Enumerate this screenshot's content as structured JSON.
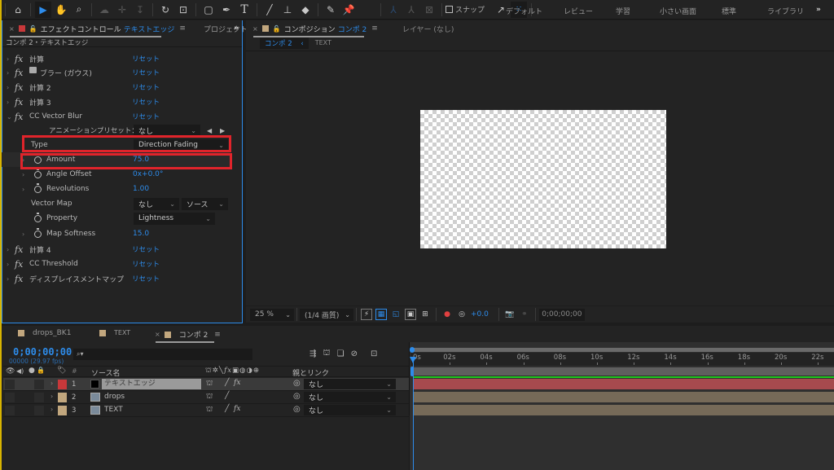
{
  "toolbar": {
    "tools": [
      "home-icon",
      "selection-tool-icon",
      "hand-tool-icon",
      "zoom-tool-icon",
      "orbit-camera-icon",
      "pan-camera-icon",
      "dolly-camera-icon",
      "rotate-tool-icon",
      "anchor-point-tool-icon",
      "rectangle-tool-icon",
      "pen-tool-icon",
      "type-tool-icon",
      "brush-tool-icon",
      "clone-stamp-icon",
      "eraser-icon",
      "roto-brush-icon",
      "puppet-pin-icon"
    ],
    "snap_label": "スナップ",
    "workspaces": [
      "デフォルト",
      "レビュー",
      "学習",
      "小さい画面",
      "標準",
      "ライブラリ"
    ],
    "more": "»"
  },
  "effect_panel": {
    "tab_label": "エフェクトコントロール",
    "tab_layer": "テキストエッジ",
    "project_tab": "プロジェクト",
    "more": "»",
    "breadcrumb": "コンポ 2・テキストエッジ",
    "reset_label": "リセット",
    "effects": [
      {
        "name": "計算",
        "expanded": false
      },
      {
        "name": "ブラー (ガウス)",
        "expanded": false
      },
      {
        "name": "計算 2",
        "expanded": false
      },
      {
        "name": "計算 3",
        "expanded": false
      },
      {
        "name": "CC Vector Blur",
        "expanded": true
      },
      {
        "name": "計算 4",
        "expanded": false
      },
      {
        "name": "CC Threshold",
        "expanded": false
      },
      {
        "name": "ディスプレイスメントマップ",
        "expanded": false
      }
    ],
    "preset_label": "アニメーションプリセット：",
    "preset_value": "なし",
    "params": {
      "type_label": "Type",
      "type_value": "Direction Fading",
      "amount_label": "Amount",
      "amount_value": "75.0",
      "angle_label": "Angle Offset",
      "angle_value": "0x+0.0°",
      "revolutions_label": "Revolutions",
      "revolutions_value": "1.00",
      "vector_map_label": "Vector Map",
      "vector_map_value": "なし",
      "vector_map_source": "ソース",
      "property_label": "Property",
      "property_value": "Lightness",
      "softness_label": "Map Softness",
      "softness_value": "15.0"
    }
  },
  "comp_panel": {
    "tab_label": "コンポジション",
    "tab_comp": "コンポ 2",
    "layer_tab": "レイヤー (なし)",
    "flow_current": "コンポ 2",
    "flow_prev": "TEXT",
    "zoom": "25 %",
    "quality": "(1/4 画質)",
    "exposure": "+0.0",
    "timecode": "0;00;00;00"
  },
  "timeline": {
    "tabs": [
      "drops_BK1",
      "TEXT",
      "コンポ 2"
    ],
    "tab_colors": [
      "#c2a77e",
      "#c2a77e",
      "#c2a77e"
    ],
    "current_time": "0;00;00;00",
    "frame_info": "00000 (29.97 fps)",
    "search_placeholder": "",
    "col_source": "ソース名",
    "col_parent": "親とリンク",
    "ruler": [
      "0s",
      "02s",
      "04s",
      "06s",
      "08s",
      "10s",
      "12s",
      "14s",
      "16s",
      "18s",
      "20s",
      "22s"
    ],
    "layers": [
      {
        "num": "1",
        "name": "テキストエッジ",
        "label_color": "#c8383a",
        "has_fx": true,
        "parent": "なし",
        "selected": true
      },
      {
        "num": "2",
        "name": "drops",
        "label_color": "#c2a77e",
        "has_fx": false,
        "parent": "なし",
        "selected": false
      },
      {
        "num": "3",
        "name": "TEXT",
        "label_color": "#c2a77e",
        "has_fx": true,
        "parent": "なし",
        "selected": false
      }
    ]
  },
  "colors": {
    "accent": "#2d8ceb",
    "highlight_box": "#e0242b",
    "work_area": "#1ec81e"
  }
}
